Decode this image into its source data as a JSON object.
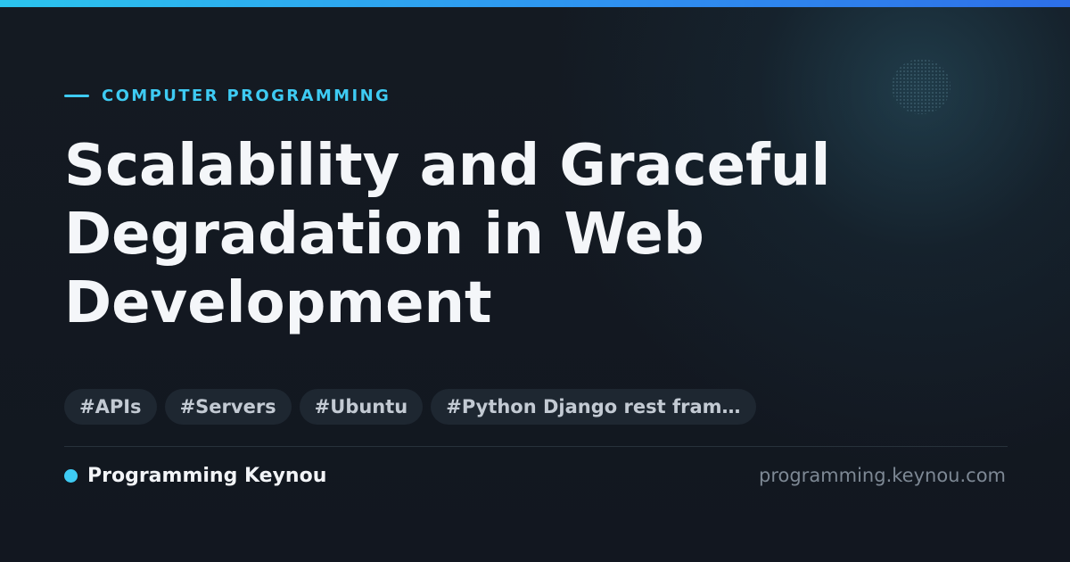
{
  "category": "COMPUTER PROGRAMMING",
  "title": "Scalability and Graceful Degradation in Web Development",
  "tags": [
    "#APIs",
    "#Servers",
    "#Ubuntu",
    "#Python Django rest fram…"
  ],
  "footer": {
    "brand": "Programming Keynou",
    "url": "programming.keynou.com"
  },
  "colors": {
    "accent": "#3ecbf3",
    "background": "#131820",
    "tag_background": "#1e2731",
    "title": "#f4f6f9"
  }
}
